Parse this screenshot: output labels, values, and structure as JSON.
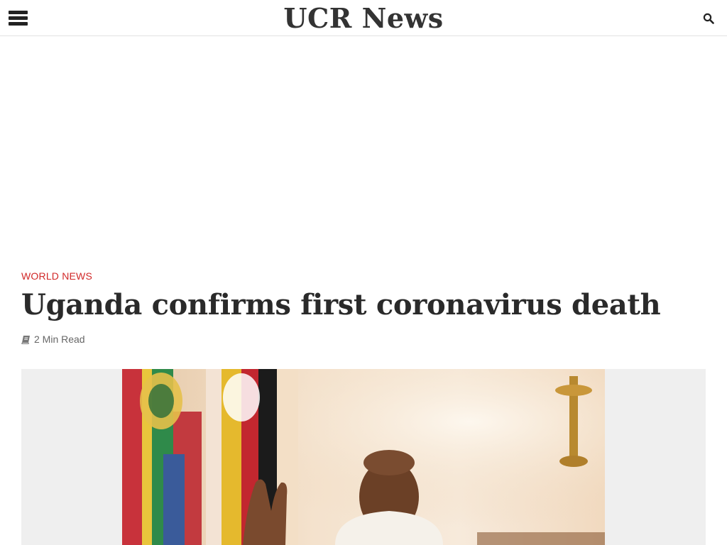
{
  "header": {
    "site_title": "UCR News",
    "menu_icon": "hamburger-menu-icon",
    "search_icon": "search-icon"
  },
  "article": {
    "category": "WORLD NEWS",
    "title": "Uganda confirms first coronavirus death",
    "read_time": "2 Min Read",
    "read_time_icon": "book-icon"
  },
  "colors": {
    "accent": "#d12828",
    "title": "#2a2a2a",
    "meta": "#666666",
    "image_bg": "#efefef"
  }
}
